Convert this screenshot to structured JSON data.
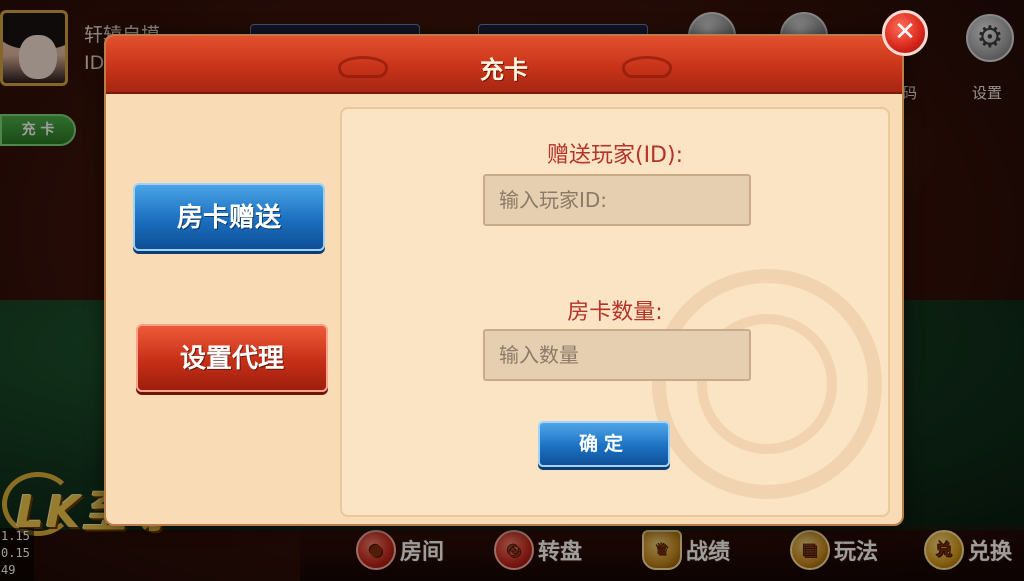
{
  "lobby": {
    "user_name": "轩辕自摸",
    "user_id_label": "ID",
    "recharge_label": "充 卡",
    "settings_label": "设置",
    "code_label": "码",
    "logo_text": "LK至尊",
    "fps_lines": [
      "1.15",
      "0.15",
      "49"
    ]
  },
  "bottom_nav": [
    {
      "label": "房间",
      "icon": "room-icon"
    },
    {
      "label": "转盘",
      "icon": "wheel-icon"
    },
    {
      "label": "战绩",
      "icon": "trophy-icon"
    },
    {
      "label": "玩法",
      "icon": "rules-icon"
    },
    {
      "label": "兑换",
      "icon": "money-bag-icon"
    }
  ],
  "modal": {
    "title": "充卡",
    "close_icon": "close-icon",
    "gift_card_button": "房卡赠送",
    "set_agent_button": "设置代理",
    "gift_player_label": "赠送玩家(ID):",
    "player_id_placeholder": "输入玩家ID:",
    "card_qty_label": "房卡数量:",
    "qty_placeholder": "输入数量",
    "confirm_button": "确定"
  },
  "colors": {
    "modal_bg": "#f9dcb6",
    "header_red": "#c8341a",
    "blue_button": "#1b6fbf",
    "red_button": "#c62f17",
    "label_red": "#b4332a"
  }
}
